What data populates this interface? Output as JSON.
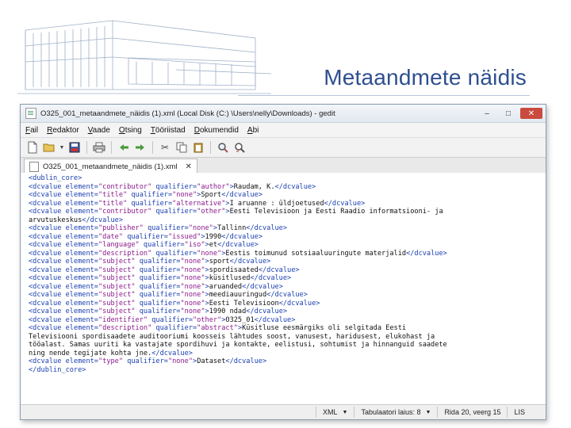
{
  "slide": {
    "title": "Metaandmete näidis"
  },
  "window": {
    "title": "O325_001_metaandmete_näidis (1).xml (Local Disk (C:) \\Users\\nelly\\Downloads) - gedit",
    "controls": {
      "minimize": "–",
      "maximize": "□",
      "close": "✕"
    }
  },
  "menu": [
    "Fail",
    "Redaktor",
    "Vaade",
    "Otsing",
    "Tööriistad",
    "Dokumendid",
    "Abi"
  ],
  "toolbar_icons": [
    "new-document-icon",
    "open-icon",
    "open-dropdown-icon",
    "save-icon",
    "print-icon",
    "undo-icon",
    "redo-icon",
    "cut-icon",
    "copy-icon",
    "paste-icon",
    "find-icon",
    "replace-icon"
  ],
  "tab": {
    "label": "O325_001_metaandmete_näidis (1).xml",
    "close": "✕"
  },
  "editor": {
    "lines": [
      [
        [
          "t",
          "<dublin_core>"
        ]
      ],
      [
        [
          "t",
          "<dcvalue "
        ],
        [
          "a",
          "element="
        ],
        [
          "v",
          "\"contributor\""
        ],
        [
          "a",
          " qualifier="
        ],
        [
          "v",
          "\"author\""
        ],
        [
          "t",
          ">"
        ],
        [
          "x",
          "Raudam, K."
        ],
        [
          "t",
          "</dcvalue>"
        ]
      ],
      [
        [
          "t",
          "<dcvalue "
        ],
        [
          "a",
          "element="
        ],
        [
          "v",
          "\"title\""
        ],
        [
          "a",
          " qualifier="
        ],
        [
          "v",
          "\"none\""
        ],
        [
          "t",
          ">"
        ],
        [
          "x",
          "Sport"
        ],
        [
          "t",
          "</dcvalue>"
        ]
      ],
      [
        [
          "t",
          "<dcvalue "
        ],
        [
          "a",
          "element="
        ],
        [
          "v",
          "\"title\""
        ],
        [
          "a",
          " qualifier="
        ],
        [
          "v",
          "\"alternative\""
        ],
        [
          "t",
          ">"
        ],
        [
          "x",
          "I aruanne : üldjoetused"
        ],
        [
          "t",
          "</dcvalue>"
        ]
      ],
      [
        [
          "t",
          "<dcvalue "
        ],
        [
          "a",
          "element="
        ],
        [
          "v",
          "\"contributor\""
        ],
        [
          "a",
          " qualifier="
        ],
        [
          "v",
          "\"other\""
        ],
        [
          "t",
          ">"
        ],
        [
          "x",
          "Eesti Televisioon ja Eesti Raadio informatsiooni- ja"
        ]
      ],
      [
        [
          "x",
          "arvutuskeskus"
        ],
        [
          "t",
          "</dcvalue>"
        ]
      ],
      [
        [
          "t",
          "<dcvalue "
        ],
        [
          "a",
          "element="
        ],
        [
          "v",
          "\"publisher\""
        ],
        [
          "a",
          " qualifier="
        ],
        [
          "v",
          "\"none\""
        ],
        [
          "t",
          ">"
        ],
        [
          "x",
          "Tallinn"
        ],
        [
          "t",
          "</dcvalue>"
        ]
      ],
      [
        [
          "t",
          "<dcvalue "
        ],
        [
          "a",
          "element="
        ],
        [
          "v",
          "\"date\""
        ],
        [
          "a",
          " qualifier="
        ],
        [
          "v",
          "\"issued\""
        ],
        [
          "t",
          ">"
        ],
        [
          "x",
          "1990"
        ],
        [
          "t",
          "</dcvalue>"
        ]
      ],
      [
        [
          "t",
          "<dcvalue "
        ],
        [
          "a",
          "element="
        ],
        [
          "v",
          "\"language\""
        ],
        [
          "a",
          " qualifier="
        ],
        [
          "v",
          "\"iso\""
        ],
        [
          "t",
          ">"
        ],
        [
          "x",
          "et"
        ],
        [
          "t",
          "</dcvalue>"
        ]
      ],
      [
        [
          "t",
          "<dcvalue "
        ],
        [
          "a",
          "element="
        ],
        [
          "v",
          "\"description\""
        ],
        [
          "a",
          " qualifier="
        ],
        [
          "v",
          "\"none\""
        ],
        [
          "t",
          ">"
        ],
        [
          "x",
          "Eestis toimunud sotsiaaluuringute materjalid"
        ],
        [
          "t",
          "</dcvalue>"
        ]
      ],
      [
        [
          "t",
          "<dcvalue "
        ],
        [
          "a",
          "element="
        ],
        [
          "v",
          "\"subject\""
        ],
        [
          "a",
          " qualifier="
        ],
        [
          "v",
          "\"none\""
        ],
        [
          "t",
          ">"
        ],
        [
          "x",
          "sport"
        ],
        [
          "t",
          "</dcvalue>"
        ]
      ],
      [
        [
          "t",
          "<dcvalue "
        ],
        [
          "a",
          "element="
        ],
        [
          "v",
          "\"subject\""
        ],
        [
          "a",
          " qualifier="
        ],
        [
          "v",
          "\"none\""
        ],
        [
          "t",
          ">"
        ],
        [
          "x",
          "spordisaated"
        ],
        [
          "t",
          "</dcvalue>"
        ]
      ],
      [
        [
          "t",
          "<dcvalue "
        ],
        [
          "a",
          "element="
        ],
        [
          "v",
          "\"subject\""
        ],
        [
          "a",
          " qualifier="
        ],
        [
          "v",
          "\"none\""
        ],
        [
          "t",
          ">"
        ],
        [
          "x",
          "küsitlused"
        ],
        [
          "t",
          "</dcvalue>"
        ]
      ],
      [
        [
          "t",
          "<dcvalue "
        ],
        [
          "a",
          "element="
        ],
        [
          "v",
          "\"subject\""
        ],
        [
          "a",
          " qualifier="
        ],
        [
          "v",
          "\"none\""
        ],
        [
          "t",
          ">"
        ],
        [
          "x",
          "aruanded"
        ],
        [
          "t",
          "</dcvalue>"
        ]
      ],
      [
        [
          "t",
          "<dcvalue "
        ],
        [
          "a",
          "element="
        ],
        [
          "v",
          "\"subject\""
        ],
        [
          "a",
          " qualifier="
        ],
        [
          "v",
          "\"none\""
        ],
        [
          "t",
          ">"
        ],
        [
          "x",
          "meediauuringud"
        ],
        [
          "t",
          "</dcvalue>"
        ]
      ],
      [
        [
          "t",
          "<dcvalue "
        ],
        [
          "a",
          "element="
        ],
        [
          "v",
          "\"subject\""
        ],
        [
          "a",
          " qualifier="
        ],
        [
          "v",
          "\"none\""
        ],
        [
          "t",
          ">"
        ],
        [
          "x",
          "Eesti Televisioon"
        ],
        [
          "t",
          "</dcvalue>"
        ]
      ],
      [
        [
          "t",
          "<dcvalue "
        ],
        [
          "a",
          "element="
        ],
        [
          "v",
          "\"subject\""
        ],
        [
          "a",
          " qualifier="
        ],
        [
          "v",
          "\"none\""
        ],
        [
          "t",
          ">"
        ],
        [
          "x",
          "1990 ndad"
        ],
        [
          "t",
          "</dcvalue>"
        ]
      ],
      [
        [
          "t",
          "<dcvalue "
        ],
        [
          "a",
          "element="
        ],
        [
          "v",
          "\"identifier\""
        ],
        [
          "a",
          " qualifier="
        ],
        [
          "v",
          "\"other\""
        ],
        [
          "t",
          ">"
        ],
        [
          "x",
          "O325_01"
        ],
        [
          "t",
          "</dcvalue>"
        ]
      ],
      [
        [
          "t",
          "<dcvalue "
        ],
        [
          "a",
          "element="
        ],
        [
          "v",
          "\"description\""
        ],
        [
          "a",
          " qualifier="
        ],
        [
          "v",
          "\"abstract\""
        ],
        [
          "t",
          ">"
        ],
        [
          "x",
          "Küsitluse eesmärgiks oli selgitada Eesti"
        ]
      ],
      [
        [
          "x",
          "Televisiooni spordisaadete auditooriumi koosseis lähtudes soost, vanusest, haridusest, elukohast ja"
        ]
      ],
      [
        [
          "x",
          "tööalast. Samas uuriti ka vastajate spordihuvi ja kontakte, eelistusi, sohtumist ja hinnanguid saadete"
        ]
      ],
      [
        [
          "x",
          "ning nende tegijate kohta jne."
        ],
        [
          "t",
          "</dcvalue>"
        ]
      ],
      [
        [
          "t",
          "<dcvalue "
        ],
        [
          "a",
          "element="
        ],
        [
          "v",
          "\"type\""
        ],
        [
          "a",
          " qualifier="
        ],
        [
          "v",
          "\"none\""
        ],
        [
          "t",
          ">"
        ],
        [
          "x",
          "Dataset"
        ],
        [
          "t",
          "</dcvalue>"
        ]
      ],
      [
        [
          "t",
          "</dublin_core>"
        ]
      ]
    ]
  },
  "status": {
    "language": "XML",
    "tab_width": "Tabulaatori laius:  8",
    "position": "Rida 20, veerg 15",
    "mode": "LIS"
  }
}
